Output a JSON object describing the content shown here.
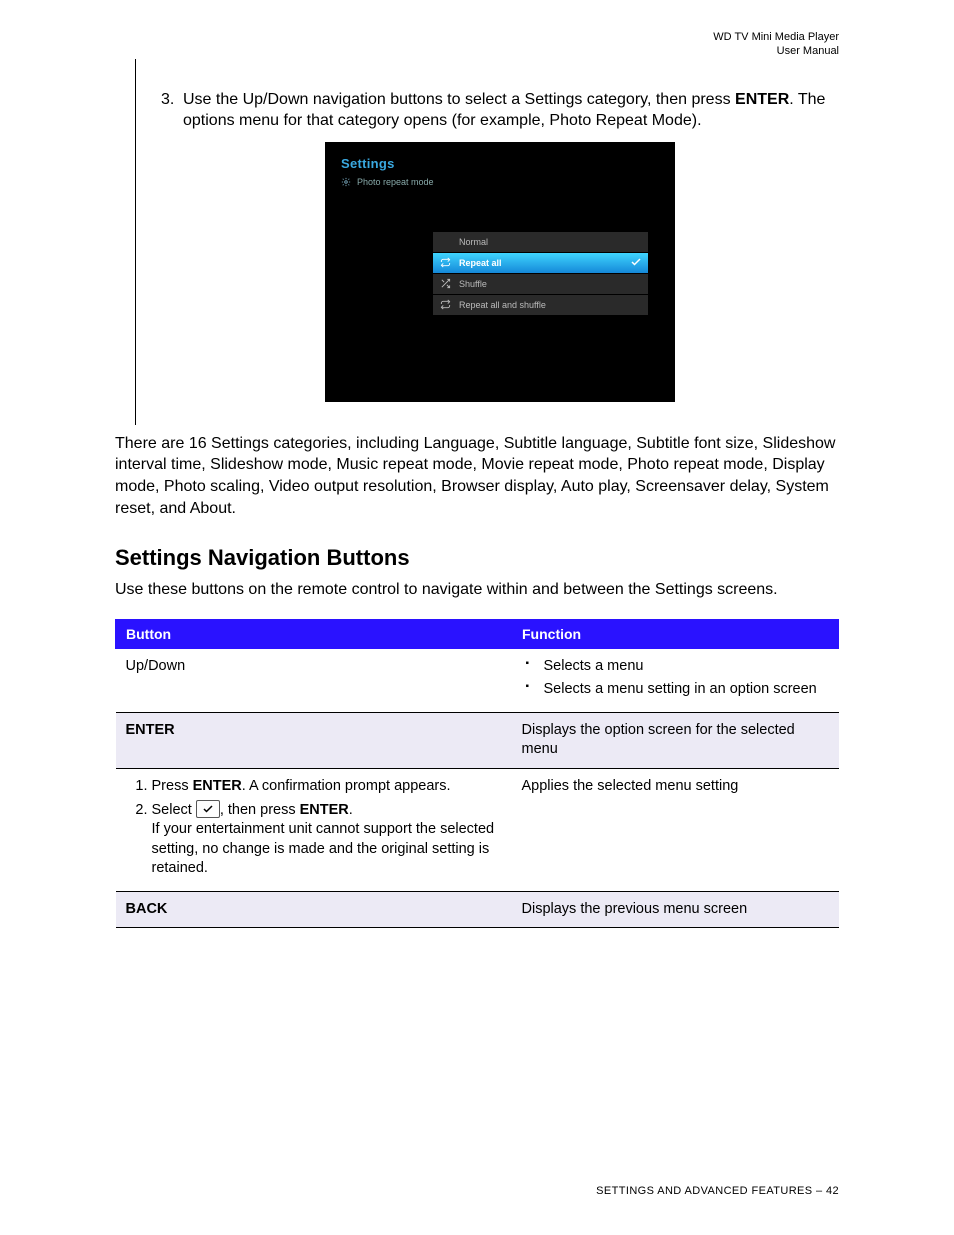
{
  "header": {
    "line1": "WD TV Mini Media Player",
    "line2": "User Manual"
  },
  "step": {
    "num": "3.",
    "pre": "Use the Up/Down navigation buttons to select a Settings category, then press ",
    "enter": "ENTER",
    "post": ". The options menu for that category opens (for example, Photo Repeat Mode)."
  },
  "screenshot": {
    "title": "Settings",
    "subtitle": "Photo repeat mode",
    "options": [
      {
        "label": "Normal",
        "selected": false,
        "icon": ""
      },
      {
        "label": "Repeat all",
        "selected": true,
        "icon": "repeat"
      },
      {
        "label": "Shuffle",
        "selected": false,
        "icon": "shuffle"
      },
      {
        "label": "Repeat all and shuffle",
        "selected": false,
        "icon": "repeat-shuffle"
      }
    ]
  },
  "categories_para": "There are 16 Settings categories, including Language, Subtitle language, Subtitle font size, Slideshow interval time, Slideshow mode, Music repeat mode, Movie repeat mode, Photo repeat mode, Display mode, Photo scaling, Video output resolution, Browser display, Auto play, Screensaver delay, System reset, and About.",
  "section_heading": "Settings Navigation Buttons",
  "section_intro": "Use these buttons on the remote control to navigate within and between the Settings screens.",
  "table": {
    "headers": {
      "button": "Button",
      "function": "Function"
    },
    "rows": [
      {
        "tint": false,
        "button_plain": "Up/Down",
        "function_bullets": [
          "Selects a menu",
          "Selects a menu setting in an option screen"
        ]
      },
      {
        "tint": true,
        "button_bold": "ENTER",
        "function_plain": "Displays the option screen for the selected menu"
      },
      {
        "tint": false,
        "button_ordered": {
          "i1_pre": "Press ",
          "i1_bold": "ENTER",
          "i1_post": ". A confirmation prompt appears.",
          "i2_pre": "Select ",
          "i2_post_pre": ", then press ",
          "i2_bold": "ENTER",
          "i2_post": ".",
          "i2_note": "If your entertainment unit cannot support the selected setting, no change is made and the original setting is retained."
        },
        "function_plain": "Applies the selected menu setting"
      },
      {
        "tint": true,
        "button_bold": "BACK",
        "function_plain": "Displays the previous menu screen"
      }
    ]
  },
  "footer": "SETTINGS AND ADVANCED FEATURES – 42"
}
